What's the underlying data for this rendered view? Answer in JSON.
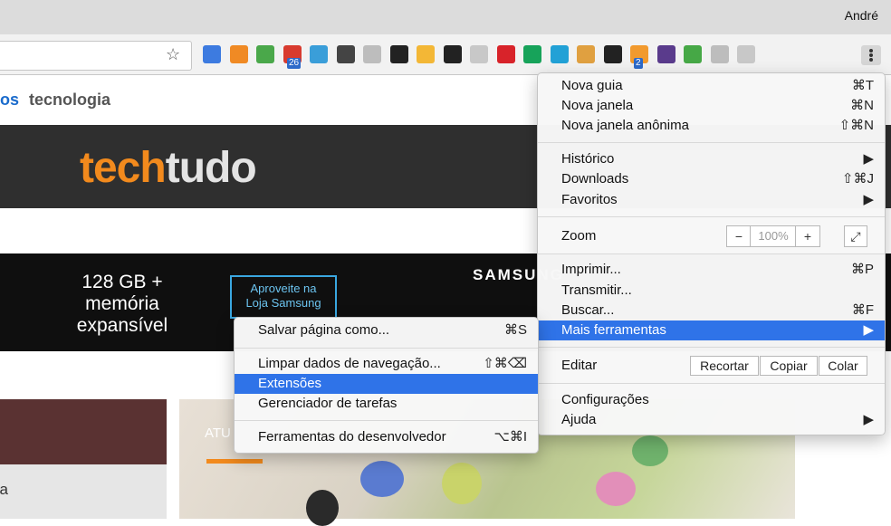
{
  "window": {
    "user": "André"
  },
  "toolbar": {
    "extensions": [
      {
        "name": "check-extension",
        "color": "#3d7be0"
      },
      {
        "name": "chart-extension",
        "color": "#f08a24"
      },
      {
        "name": "stack-extension",
        "color": "#4aa84a"
      },
      {
        "name": "calendar-extension",
        "color": "#d83b2f",
        "badge": "26"
      },
      {
        "name": "camera-extension",
        "color": "#3a9ed9"
      },
      {
        "name": "pocket-extension",
        "color": "#444444"
      },
      {
        "name": "lightning-extension",
        "color": "#bdbdbd"
      },
      {
        "name": "phone-extension",
        "color": "#222222"
      },
      {
        "name": "smiley-extension",
        "color": "#f3b736"
      },
      {
        "name": "copy-extension",
        "color": "#222222"
      },
      {
        "name": "link-extension",
        "color": "#c8c8c8"
      },
      {
        "name": "pinterest-extension",
        "color": "#d8232a"
      },
      {
        "name": "grammar-extension",
        "color": "#17a35a"
      },
      {
        "name": "wordpress-extension",
        "color": "#22a1d6"
      },
      {
        "name": "face-extension",
        "color": "#e0a040"
      },
      {
        "name": "buffer-extension",
        "color": "#222222"
      },
      {
        "name": "tag-extension",
        "color": "#f29a2e",
        "badge": "2"
      },
      {
        "name": "producthunt-extension",
        "color": "#5a3b8c"
      },
      {
        "name": "screen-extension",
        "color": "#46a846"
      },
      {
        "name": "pause-extension",
        "color": "#bdbdbd"
      },
      {
        "name": "e-extension",
        "color": "#c8c8c8"
      }
    ]
  },
  "site": {
    "nav": {
      "partial": "os",
      "item": "tecnologia"
    },
    "logo": {
      "part1": "tech",
      "part2": "tudo"
    },
    "ad": {
      "line1": "128 GB +",
      "line2": "memória",
      "line3": "expansível",
      "cta1": "Aproveite na",
      "cta2": "Loja Samsung",
      "brand": "SAMSUNG"
    },
    "card_left_text": "na",
    "card_img_text": "ATU"
  },
  "menu": {
    "new_tab": "Nova guia",
    "new_tab_sc": "⌘T",
    "new_window": "Nova janela",
    "new_window_sc": "⌘N",
    "incognito": "Nova janela anônima",
    "incognito_sc": "⇧⌘N",
    "history": "Histórico",
    "history_sc": "▶",
    "downloads": "Downloads",
    "downloads_sc": "⇧⌘J",
    "bookmarks": "Favoritos",
    "bookmarks_sc": "▶",
    "zoom": "Zoom",
    "zoom_minus": "−",
    "zoom_value": "100%",
    "zoom_plus": "+",
    "fullscreen": "⤢",
    "print": "Imprimir...",
    "print_sc": "⌘P",
    "cast": "Transmitir...",
    "find": "Buscar...",
    "find_sc": "⌘F",
    "more_tools": "Mais ferramentas",
    "more_tools_sc": "▶",
    "edit": "Editar",
    "cut": "Recortar",
    "copy": "Copiar",
    "paste": "Colar",
    "settings": "Configurações",
    "help": "Ajuda",
    "help_sc": "▶"
  },
  "submenu": {
    "save_page": "Salvar página como...",
    "save_page_sc": "⌘S",
    "clear_data": "Limpar dados de navegação...",
    "clear_data_sc": "⇧⌘⌫",
    "extensions": "Extensões",
    "task_manager": "Gerenciador de tarefas",
    "dev_tools": "Ferramentas do desenvolvedor",
    "dev_tools_sc": "⌥⌘I"
  }
}
